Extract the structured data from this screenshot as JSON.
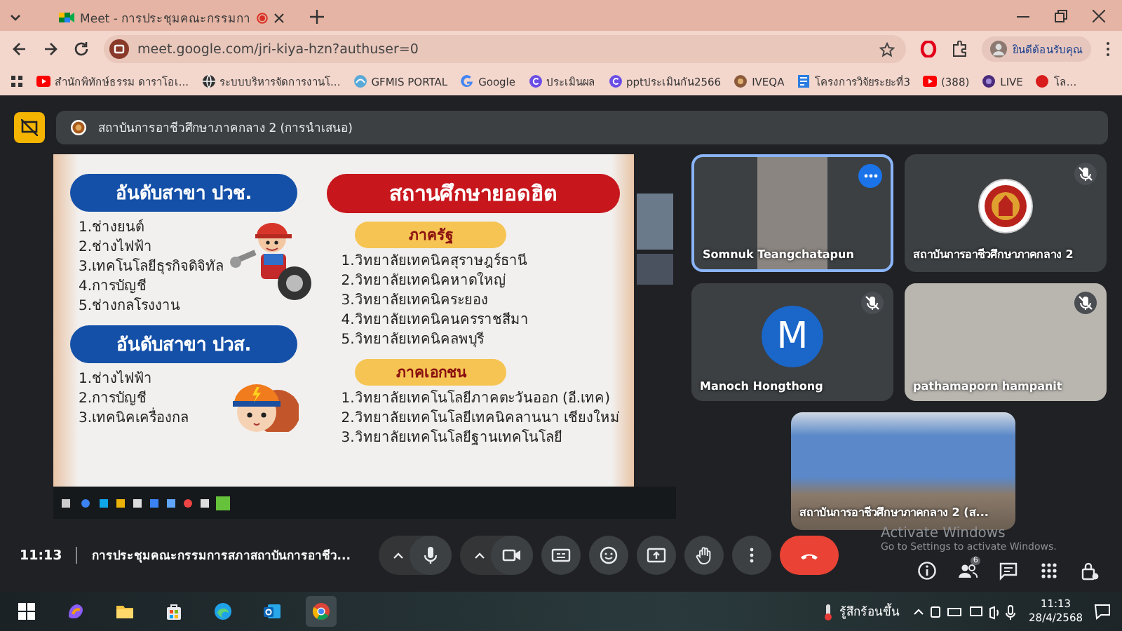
{
  "browser": {
    "tab": {
      "title": "Meet - การประชุมคณะกรรมกา",
      "recording": true
    },
    "address": "meet.google.com/jri-kiya-hzn?authuser=0",
    "profile": "ยินดีต้อนรับคุณ",
    "bookmarks": [
      {
        "label": "สำนักพิทักษ์ธรรม ดาราโอเ...",
        "kind": "video"
      },
      {
        "label": "ระบบบริหารจัดการงานโ...",
        "kind": "globe"
      },
      {
        "label": "GFMIS PORTAL",
        "kind": "portal"
      },
      {
        "label": "Google",
        "kind": "google"
      },
      {
        "label": "ประเมินผล",
        "kind": "canva"
      },
      {
        "label": "pptประเมินกัน2566",
        "kind": "canva"
      },
      {
        "label": "IVEQA",
        "kind": "seal"
      },
      {
        "label": "โครงการวิจัยระยะที่3",
        "kind": "doc"
      },
      {
        "label": "(388)",
        "kind": "video"
      },
      {
        "label": "LIVE",
        "kind": "live"
      },
      {
        "label": "โล...",
        "kind": "dot"
      }
    ]
  },
  "meeting": {
    "presenter_banner": "สถาบันการอาชีวศึกษาภาคกลาง 2 (การนำเสนอ)",
    "slide": {
      "left_sections": [
        {
          "heading": "อันดับสาขา ปวช.",
          "items": [
            "1.ช่างยนต์",
            "2.ช่างไฟฟ้า",
            "3.เทคโนโลยีธุรกิจดิจิทัล",
            "4.การบัญชี",
            "5.ช่างกลโรงงาน"
          ]
        },
        {
          "heading": "อันดับสาขา ปวส.",
          "items": [
            "1.ช่างไฟฟ้า",
            "2.การบัญชี",
            "3.เทคนิคเครื่องกล"
          ]
        }
      ],
      "right_title": "สถานศึกษายอดฮิต",
      "right_sections": [
        {
          "heading": "ภาครัฐ",
          "items": [
            "1.วิทยาลัยเทคนิคสุราษฎร์ธานี",
            "2.วิทยาลัยเทคนิคหาดใหญ่",
            "3.วิทยาลัยเทคนิคระยอง",
            "4.วิทยาลัยเทคนิคนครราชสีมา",
            "5.วิทยาลัยเทคนิคลพบุรี"
          ]
        },
        {
          "heading": "ภาคเอกชน",
          "items": [
            "1.วิทยาลัยเทคโนโลยีภาคตะวันออก (อี.เทค)",
            "2.วิทยาลัยเทคโนโลยีเทคนิคลานนา เชียงใหม่",
            "3.วิทยาลัยเทคโนโลยีฐานเทคโนโลยี"
          ]
        }
      ]
    },
    "tiles": [
      {
        "name": "Somnuk Teangchatapun",
        "kind": "video",
        "muted": false,
        "speaking": true
      },
      {
        "name": "สถาบันการอาชีวศึกษาภาคกลาง 2",
        "kind": "logo",
        "muted": true,
        "speaking": false
      },
      {
        "name": "Manoch Hongthong",
        "kind": "avatar",
        "avatar": "M",
        "muted": true,
        "speaking": false
      },
      {
        "name": "pathamaporn hampanit",
        "kind": "video",
        "muted": true,
        "speaking": false
      },
      {
        "name": "สถาบันการอาชีวศึกษาภาคกลาง 2 (ส...",
        "kind": "room",
        "muted": false,
        "speaking": false
      }
    ],
    "time": "11:13",
    "title": "การประชุมคณะกรรมการสภาสถาบันการอาชีว...",
    "people_count": "6",
    "activation": {
      "title": "Activate Windows",
      "hint": "Go to Settings to activate Windows."
    }
  },
  "taskbar": {
    "weather": "รู้สึกร้อนขึ้น",
    "time": "11:13",
    "date": "28/4/2568"
  }
}
